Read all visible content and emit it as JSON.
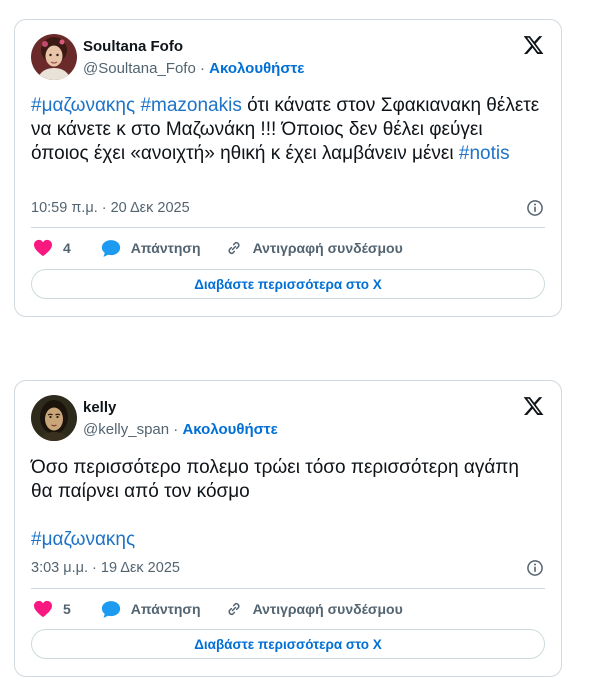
{
  "tweets": [
    {
      "display_name": "Soultana Fofo",
      "handle": "@Soultana_Fofo",
      "separator": "·",
      "follow_label": "Ακολουθήστε",
      "text_parts": {
        "h1": "#μαζωνακης",
        "h2": "#mazonakis",
        "body": " ότι κάνατε στον Σφακιανακη θέλετε να κάνετε κ στο Μαζωνάκη !!! Όποιος δεν θέλει φεύγει όποιος έχει «ανοιχτή» ηθική κ έχει λαμβάνειν μένει ",
        "h3": "#notis"
      },
      "timestamp": "10:59 π.μ. · 20 Δεκ 2025",
      "like_count": "4",
      "reply_label": "Απάντηση",
      "copy_link_label": "Αντιγραφή συνδέσμου",
      "read_more_label": "Διαβάστε περισσότερα στο X",
      "avatar_icon": "woman-portrait-avatar"
    },
    {
      "display_name": "kelly",
      "handle": "@kelly_span",
      "separator": "·",
      "follow_label": "Ακολουθήστε",
      "text_parts": {
        "body": "Όσο περισσότερο πολεμο τρώει τόσο περισσότερη αγάπη θα παίρνει από τον κόσμο",
        "h1": "#μαζωνακης"
      },
      "timestamp": "3:03 μ.μ. · 19 Δεκ 2025",
      "like_count": "5",
      "reply_label": "Απάντηση",
      "copy_link_label": "Αντιγραφή συνδέσμου",
      "read_more_label": "Διαβάστε περισσότερα στο X",
      "avatar_icon": "portrait-painting-avatar"
    }
  ],
  "colors": {
    "link": "#006fd6",
    "hashtag": "#1d73c7",
    "like": "#f91880",
    "reply": "#1d9bf0",
    "border": "#cfd9de",
    "muted": "#536471"
  },
  "icons": [
    "x-logo-icon",
    "info-icon",
    "heart-icon",
    "reply-bubble-icon",
    "link-icon"
  ]
}
